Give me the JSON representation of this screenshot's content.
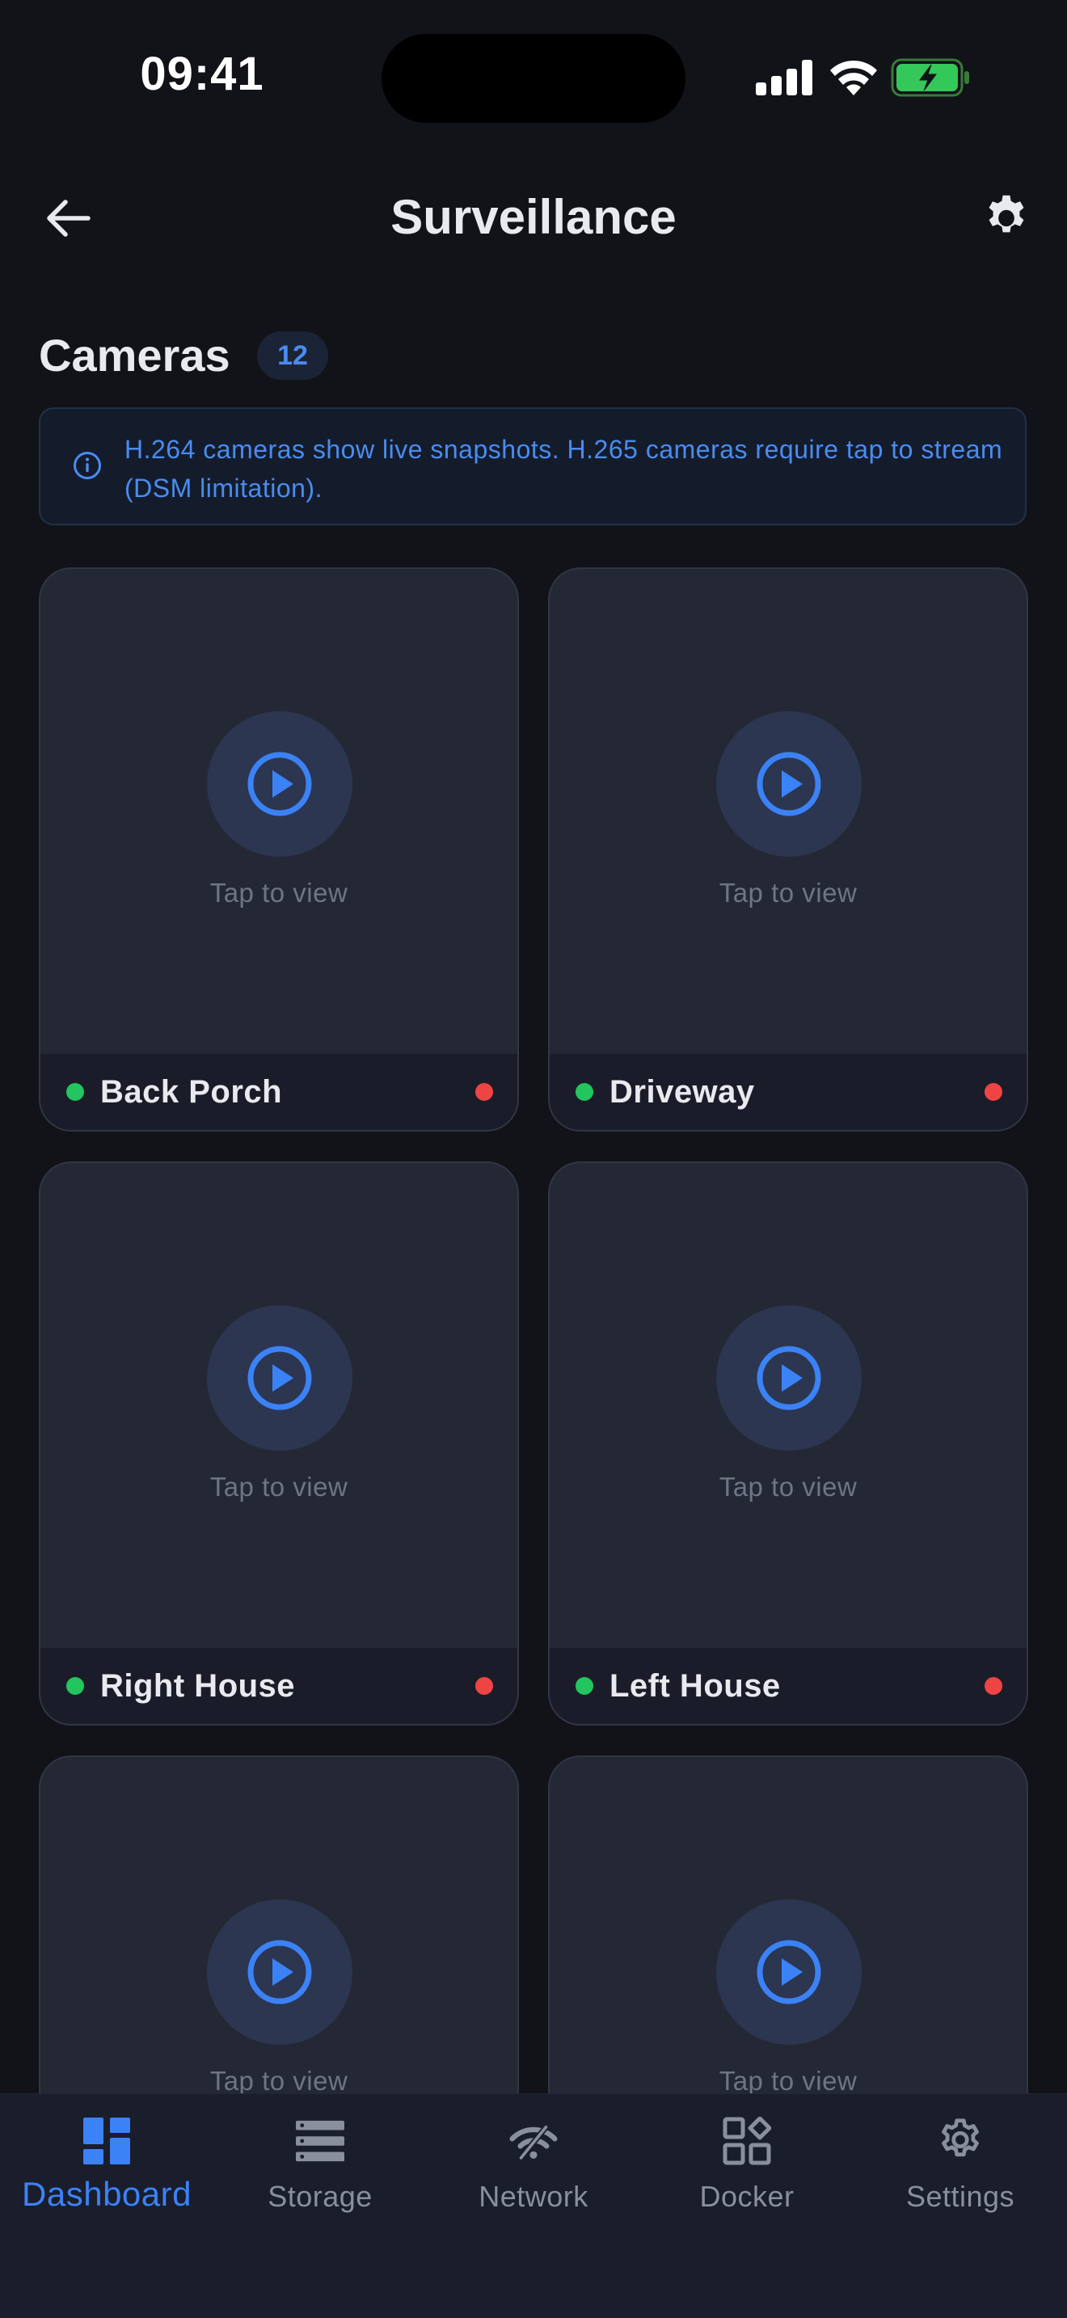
{
  "status_bar": {
    "time": "09:41"
  },
  "header": {
    "title": "Surveillance"
  },
  "section": {
    "title": "Cameras",
    "count": "12"
  },
  "info_banner": {
    "text": "H.264 cameras show live snapshots. H.265 cameras require tap to stream (DSM limitation)."
  },
  "cameras": [
    {
      "name": "Back Porch",
      "tap_label": "Tap to view"
    },
    {
      "name": "Driveway",
      "tap_label": "Tap to view"
    },
    {
      "name": "Right House",
      "tap_label": "Tap to view"
    },
    {
      "name": "Left House",
      "tap_label": "Tap to view"
    },
    {
      "tap_label": "Tap to view"
    },
    {
      "tap_label": "Tap to view"
    }
  ],
  "tab_bar": {
    "active": "Dashboard",
    "tabs": [
      {
        "label": "Dashboard",
        "icon": "dashboard-icon"
      },
      {
        "label": "Storage",
        "icon": "storage-icon"
      },
      {
        "label": "Network",
        "icon": "network-icon"
      },
      {
        "label": "Docker",
        "icon": "docker-icon"
      },
      {
        "label": "Settings",
        "icon": "gear-icon"
      }
    ]
  },
  "colors": {
    "background": "#111318",
    "accent": "#3b82f6",
    "online": "#22c55e",
    "recording": "#ef4444",
    "card": "#242835"
  }
}
